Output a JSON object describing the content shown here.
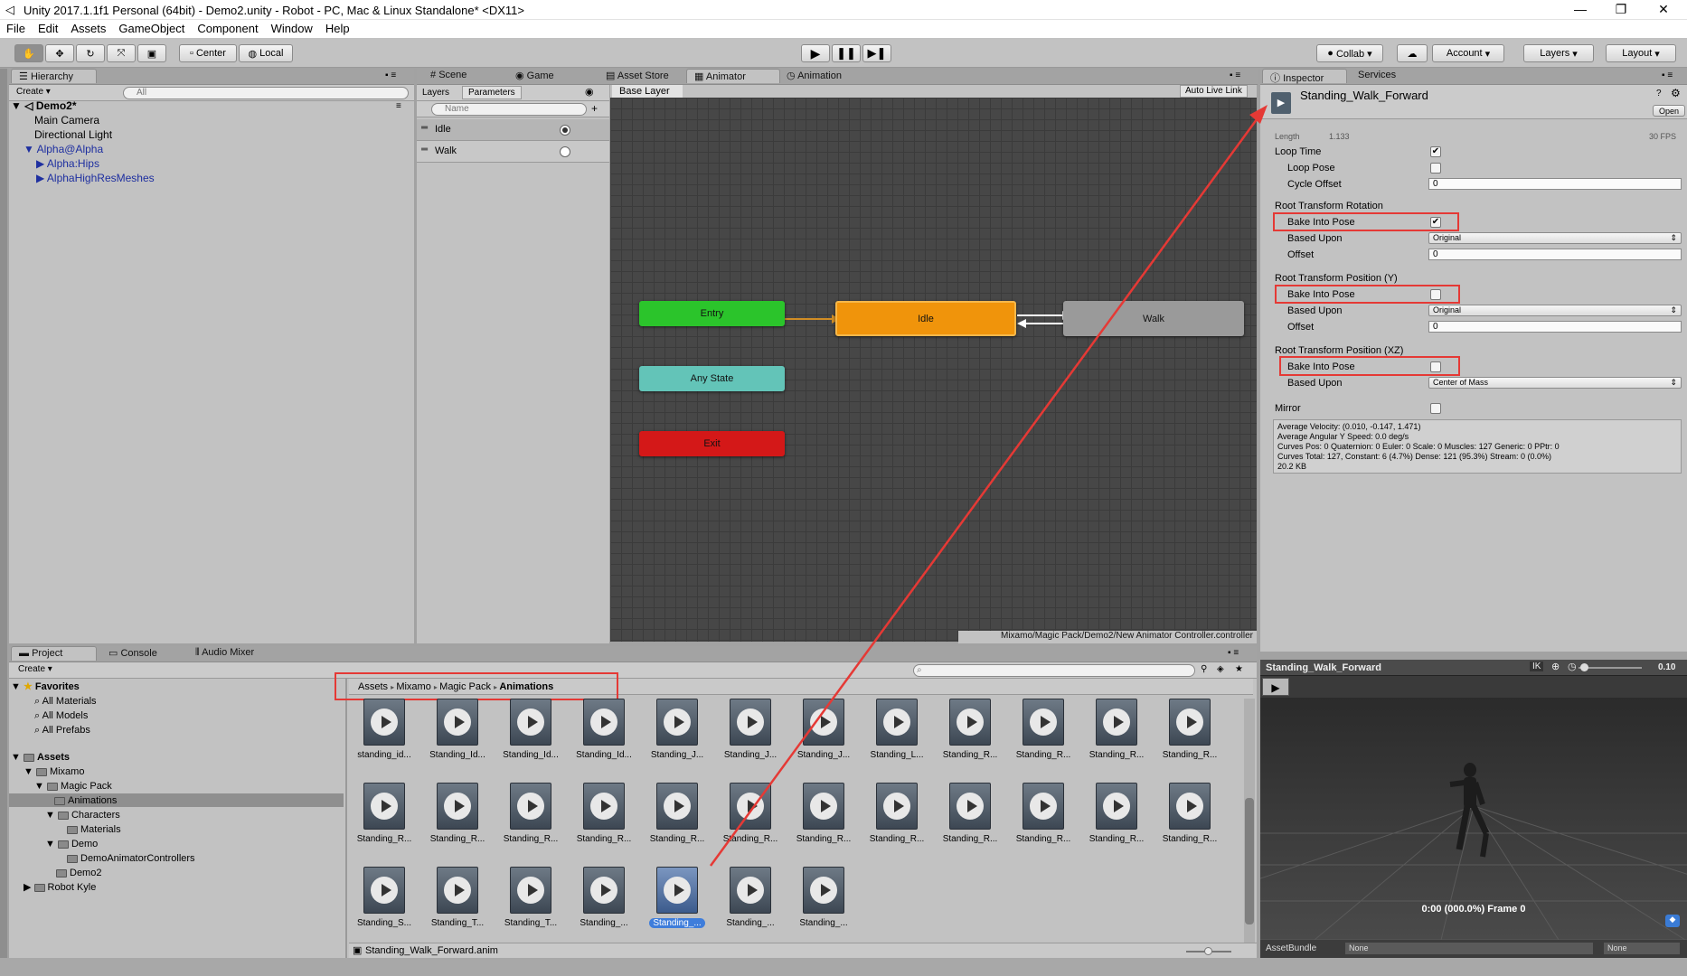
{
  "title": "Unity 2017.1.1f1 Personal (64bit) - Demo2.unity - Robot - PC, Mac & Linux Standalone* <DX11>",
  "menu": [
    "File",
    "Edit",
    "Assets",
    "GameObject",
    "Component",
    "Window",
    "Help"
  ],
  "toolbar": {
    "center": "Center",
    "local": "Local",
    "collab": "Collab ▾",
    "account": "Account",
    "layers": "Layers",
    "layout": "Layout"
  },
  "hierarchy": {
    "tab": "Hierarchy",
    "create": "Create ▾",
    "search_placeholder": "All",
    "scene": "Demo2*",
    "items": [
      "Main Camera",
      "Directional Light",
      "Alpha@Alpha",
      "Alpha:Hips",
      "AlphaHighResMeshes"
    ]
  },
  "center_tabs": {
    "scene": "Scene",
    "game": "Game",
    "asset_store": "Asset Store",
    "animator": "Animator",
    "animation": "Animation"
  },
  "animator": {
    "layers_tab": "Layers",
    "params_tab": "Parameters",
    "search_placeholder": "Name",
    "params": [
      "Idle",
      "Walk"
    ],
    "base_layer": "Base Layer",
    "auto_live": "Auto Live Link",
    "nodes": {
      "entry": "Entry",
      "idle": "Idle",
      "walk": "Walk",
      "any": "Any State",
      "exit": "Exit"
    },
    "path": "Mixamo/Magic Pack/Demo2/New Animator Controller.controller"
  },
  "inspector": {
    "tab": "Inspector",
    "services": "Services",
    "clip_name": "Standing_Walk_Forward",
    "open": "Open",
    "length_label": "Length",
    "length": "1.133",
    "fps": "30 FPS",
    "loop_time": "Loop Time",
    "loop_pose": "Loop Pose",
    "cycle_offset": "Cycle Offset",
    "cycle_offset_val": "0",
    "rot_header": "Root Transform Rotation",
    "bake": "Bake Into Pose",
    "based_upon": "Based Upon",
    "offset": "Offset",
    "rot_based": "Original",
    "rot_offset": "0",
    "posy_header": "Root Transform Position (Y)",
    "posy_based": "Original",
    "posy_offset": "0",
    "posxz_header": "Root Transform Position (XZ)",
    "posxz_based": "Center of Mass",
    "mirror": "Mirror",
    "info": [
      "Average Velocity: (0.010, -0.147, 1.471)",
      "Average Angular Y Speed: 0.0 deg/s",
      "Curves Pos: 0 Quaternion: 0 Euler: 0 Scale: 0 Muscles: 127 Generic: 0 PPtr: 0",
      "Curves Total: 127, Constant: 6 (4.7%) Dense: 121 (95.3%) Stream: 0 (0.0%)",
      "20.2 KB"
    ]
  },
  "preview": {
    "title": "Standing_Walk_Forward",
    "ik": "IK",
    "speed": "0.10",
    "time": "0:00 (000.0%) Frame 0",
    "assetbundle": "AssetBundle",
    "none1": "None",
    "none2": "None"
  },
  "project": {
    "tab": "Project",
    "console": "Console",
    "audio": "Audio Mixer",
    "create": "Create ▾",
    "favorites": "Favorites",
    "fav_items": [
      "All Materials",
      "All Models",
      "All Prefabs"
    ],
    "assets": "Assets",
    "tree": [
      "Mixamo",
      "Magic Pack",
      "Animations",
      "Characters",
      "Materials",
      "Demo",
      "DemoAnimatorControllers",
      "Demo2",
      "Robot Kyle"
    ],
    "breadcrumb": [
      "Assets",
      "Mixamo",
      "Magic Pack",
      "Animations"
    ],
    "files": [
      "standing_id...",
      "Standing_Id...",
      "Standing_Id...",
      "Standing_Id...",
      "Standing_J...",
      "Standing_J...",
      "Standing_J...",
      "Standing_L...",
      "Standing_R...",
      "Standing_R...",
      "Standing_R...",
      "Standing_R...",
      "Standing_R...",
      "Standing_R...",
      "Standing_R...",
      "Standing_R...",
      "Standing_R...",
      "Standing_R...",
      "Standing_R...",
      "Standing_R...",
      "Standing_R...",
      "Standing_R...",
      "Standing_R...",
      "Standing_R...",
      "Standing_S...",
      "Standing_T...",
      "Standing_T...",
      "Standing_...",
      "Standing_...",
      "Standing_...",
      "Standing_..."
    ],
    "selected_index": 28,
    "status": "Standing_Walk_Forward.anim"
  },
  "colors": {
    "entry": "#2bc42b",
    "idle": "#f0940b",
    "walk": "#9a9a9a",
    "any": "#63c4b8",
    "exit": "#d41818",
    "annot": "#e53935"
  }
}
